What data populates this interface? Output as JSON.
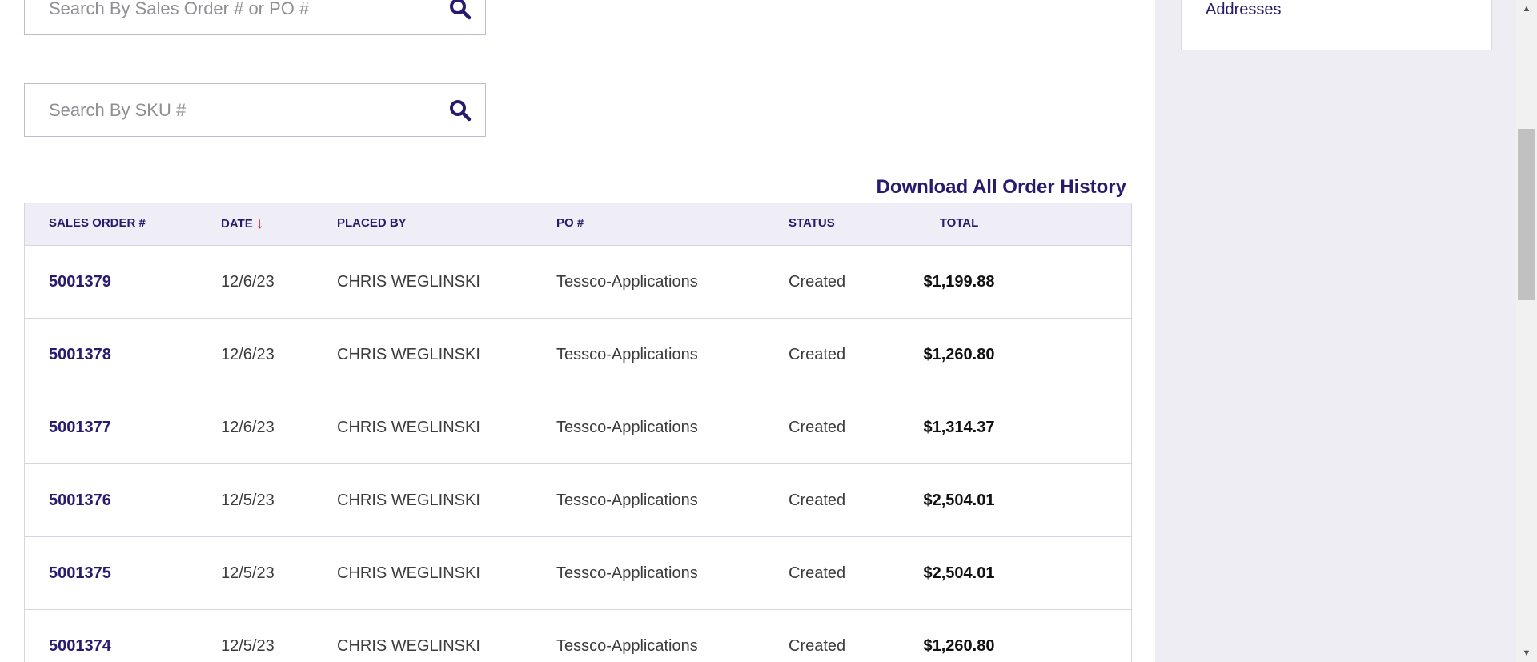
{
  "search": {
    "order_placeholder": "Search By Sales Order # or PO #",
    "sku_placeholder": "Search By SKU #"
  },
  "sidebar": {
    "link_label": "Addresses"
  },
  "download_label": "Download All Order History",
  "table": {
    "headers": {
      "sales_order": "SALES ORDER #",
      "date": "DATE",
      "placed_by": "PLACED BY",
      "po": "PO #",
      "status": "STATUS",
      "total": "TOTAL"
    },
    "sort_indicator": "↓",
    "rows": [
      {
        "order": "5001379",
        "date": "12/6/23",
        "placed_by": "CHRIS WEGLINSKI",
        "po": "Tessco-Applications",
        "status": "Created",
        "total": "$1,199.88"
      },
      {
        "order": "5001378",
        "date": "12/6/23",
        "placed_by": "CHRIS WEGLINSKI",
        "po": "Tessco-Applications",
        "status": "Created",
        "total": "$1,260.80"
      },
      {
        "order": "5001377",
        "date": "12/6/23",
        "placed_by": "CHRIS WEGLINSKI",
        "po": "Tessco-Applications",
        "status": "Created",
        "total": "$1,314.37"
      },
      {
        "order": "5001376",
        "date": "12/5/23",
        "placed_by": "CHRIS WEGLINSKI",
        "po": "Tessco-Applications",
        "status": "Created",
        "total": "$2,504.01"
      },
      {
        "order": "5001375",
        "date": "12/5/23",
        "placed_by": "CHRIS WEGLINSKI",
        "po": "Tessco-Applications",
        "status": "Created",
        "total": "$2,504.01"
      },
      {
        "order": "5001374",
        "date": "12/5/23",
        "placed_by": "CHRIS WEGLINSKI",
        "po": "Tessco-Applications",
        "status": "Created",
        "total": "$1,260.80"
      }
    ]
  },
  "icons": {
    "search": "search-icon",
    "sort": "sort-down-arrow-icon"
  },
  "colors": {
    "brand": "#2a1a6e",
    "sort_arrow": "#d81e2a",
    "header_bg": "#efeef6",
    "sidebar_bg": "#eeedf4"
  }
}
